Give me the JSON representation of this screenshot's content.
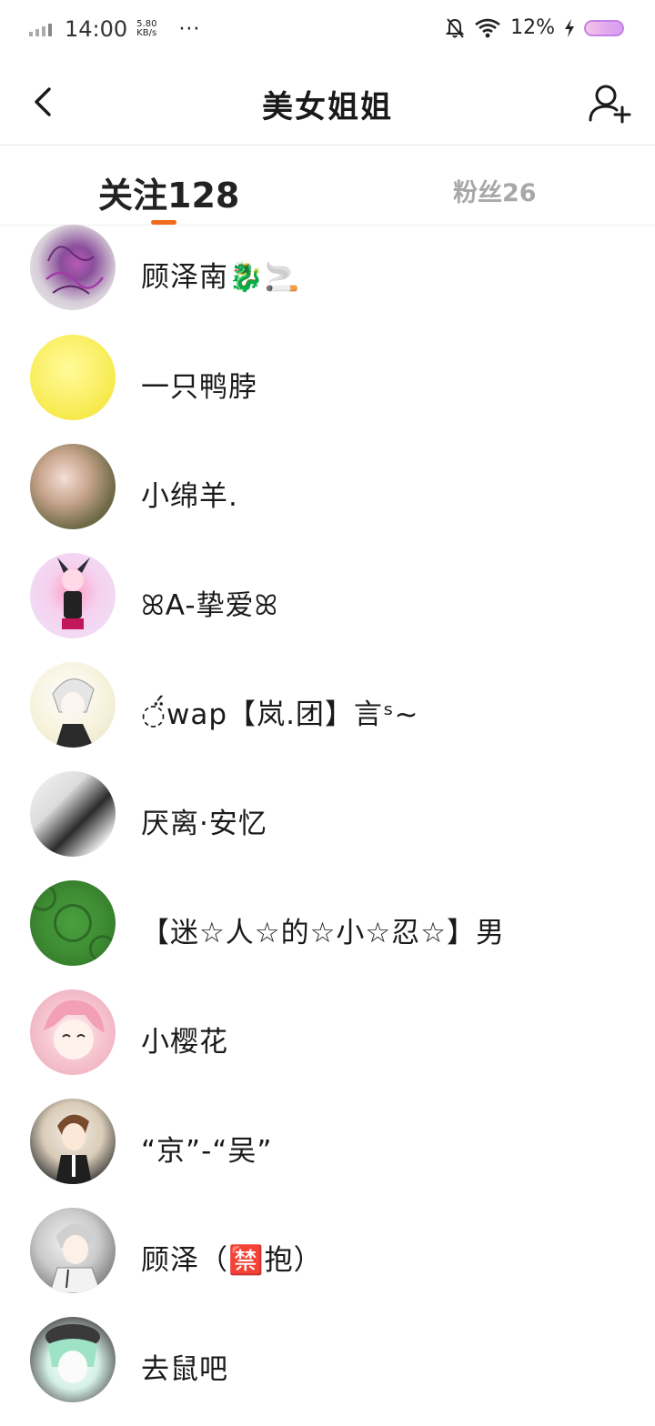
{
  "status_bar": {
    "time": "14:00",
    "net_speed_value": "5.80",
    "net_speed_unit": "KB/s",
    "more": "···",
    "battery": "12%",
    "icons": [
      "signal-icon",
      "mute-bell-icon",
      "wifi-icon",
      "charging-icon",
      "battery-icon"
    ]
  },
  "header": {
    "title": "美女姐姐",
    "back_icon": "chevron-left-icon",
    "add_icon": "add-user-icon"
  },
  "tabs": {
    "following_label": "关注128",
    "followers_label": "粉丝26",
    "indicator_color": "#f26b1d"
  },
  "users": [
    {
      "name": "顾泽南🐉🚬"
    },
    {
      "name": "一只鸭脖"
    },
    {
      "name": "小绵羊."
    },
    {
      "name": "ꕤA-挚爱ꕤ"
    },
    {
      "name": "◌̈́wap【岚.团】言ˢ~"
    },
    {
      "name": "厌离·安忆"
    },
    {
      "name": "【迷☆人☆的☆小☆忍☆】男"
    },
    {
      "name": "小樱花"
    },
    {
      "name": "“京”-“吴”"
    },
    {
      "name": "顾泽（🈲抱）"
    },
    {
      "name": "去鼠吧"
    }
  ]
}
